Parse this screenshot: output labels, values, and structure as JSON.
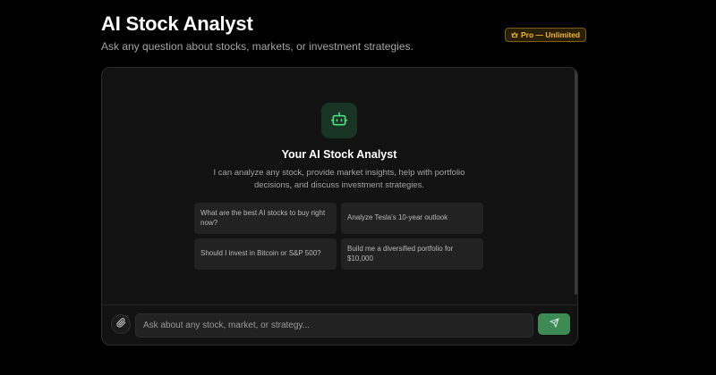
{
  "header": {
    "title": "AI Stock Analyst",
    "subtitle": "Ask any question about stocks, markets, or investment strategies.",
    "badge_label": "Pro — Unlimited",
    "badge_icon": "crown-icon"
  },
  "chat": {
    "avatar_icon": "bot-icon",
    "welcome_title": "Your AI Stock Analyst",
    "welcome_description": "I can analyze any stock, provide market insights, help with portfolio decisions, and discuss investment strategies.",
    "suggestions": [
      {
        "label": "What are the best AI stocks to buy right now?"
      },
      {
        "label": "Analyze Tesla's 10-year outlook"
      },
      {
        "label": "Should I invest in Bitcoin or S&P 500?"
      },
      {
        "label": "Build me a diversified portfolio for $10,000"
      }
    ]
  },
  "composer": {
    "attach_icon": "paperclip-icon",
    "input_placeholder": "Ask about any stock, market, or strategy...",
    "input_value": "",
    "send_icon": "send-icon"
  },
  "colors": {
    "background": "#000000",
    "card": "#121212",
    "suggestion": "#222222",
    "accent_green": "#3d8a55",
    "bot_icon_green": "#4ade80",
    "badge_gold": "#f5b82e"
  }
}
